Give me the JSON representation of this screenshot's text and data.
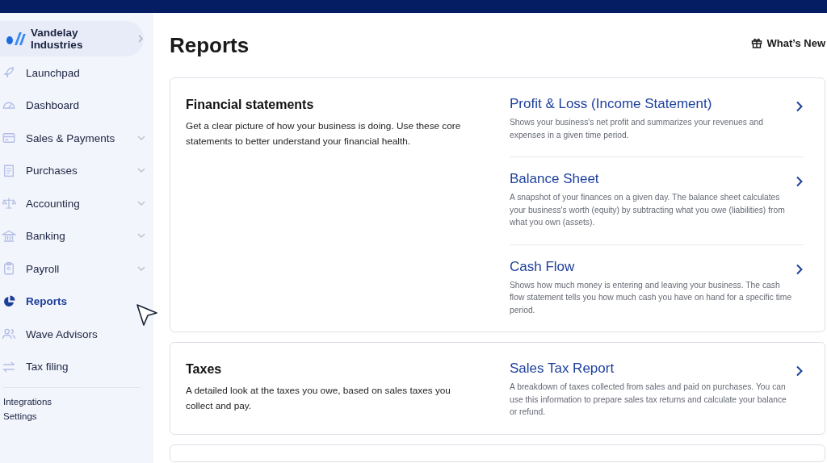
{
  "sidebar": {
    "business": "Vandelay Industries",
    "items": [
      {
        "label": "Launchpad",
        "expandable": false,
        "selected": false
      },
      {
        "label": "Dashboard",
        "expandable": false,
        "selected": false
      },
      {
        "label": "Sales & Payments",
        "expandable": true,
        "selected": false
      },
      {
        "label": "Purchases",
        "expandable": true,
        "selected": false
      },
      {
        "label": "Accounting",
        "expandable": true,
        "selected": false
      },
      {
        "label": "Banking",
        "expandable": true,
        "selected": false
      },
      {
        "label": "Payroll",
        "expandable": true,
        "selected": false
      },
      {
        "label": "Reports",
        "expandable": false,
        "selected": true
      },
      {
        "label": "Wave Advisors",
        "expandable": false,
        "selected": false
      },
      {
        "label": "Tax filing",
        "expandable": false,
        "selected": false
      }
    ],
    "footer_links": [
      "Integrations",
      "Settings"
    ]
  },
  "page": {
    "title": "Reports",
    "whats_new": "What’s New"
  },
  "sections": [
    {
      "title": "Financial statements",
      "description": "Get a clear picture of how your business is doing. Use these core statements to better understand your financial health.",
      "reports": [
        {
          "title": "Profit & Loss (Income Statement)",
          "description": "Shows your business's net profit and summarizes your revenues and expenses in a given time period."
        },
        {
          "title": "Balance Sheet",
          "description": "A snapshot of your finances on a given day. The balance sheet calculates your business's worth (equity) by subtracting what you owe (liabilities) from what you own (assets)."
        },
        {
          "title": "Cash Flow",
          "description": "Shows how much money is entering and leaving your business. The cash flow statement tells you how much cash you have on hand for a specific time period."
        }
      ]
    },
    {
      "title": "Taxes",
      "description": "A detailed look at the taxes you owe, based on sales taxes you collect and pay.",
      "reports": [
        {
          "title": "Sales Tax Report",
          "description": "A breakdown of taxes collected from sales and paid on purchases. You can use this information to prepare sales tax returns and calculate your balance or refund."
        }
      ]
    }
  ]
}
